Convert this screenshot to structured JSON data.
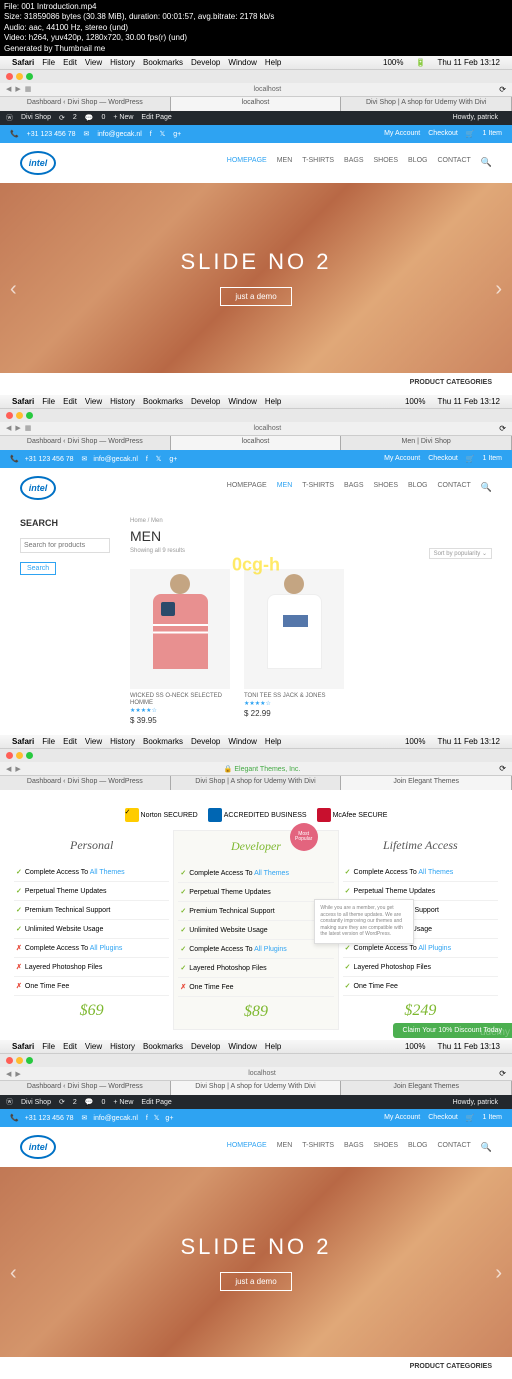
{
  "video_info": {
    "file": "File: 001 Introduction.mp4",
    "size": "Size: 31859086 bytes (30.38 MiB), duration: 00:01:57, avg.bitrate: 2178 kb/s",
    "audio": "Audio: aac, 44100 Hz, stereo (und)",
    "video": "Video: h264, yuv420p, 1280x720, 30.00 fps(r) (und)",
    "gen": "Generated by Thumbnail me"
  },
  "mac": {
    "app": "Safari",
    "menus": [
      "File",
      "Edit",
      "View",
      "History",
      "Bookmarks",
      "Develop",
      "Window",
      "Help"
    ],
    "battery": "100%",
    "datetime1": "Thu 11 Feb 13:12",
    "datetime2": "Thu 11 Feb 13:12",
    "datetime3": "Thu 11 Feb 13:12",
    "datetime4": "Thu 11 Feb 13:13"
  },
  "tabs": {
    "t1": "Dashboard ‹ Divi Shop — WordPress",
    "t2": "localhost",
    "t3": "Divi Shop | A shop for Udemy With Divi",
    "t4": "Men | Divi Shop",
    "t5": "Elegant Themes, Inc.",
    "t6": "Join Elegant Themes",
    "url": "localhost"
  },
  "wp": {
    "site": "Divi Shop",
    "updates": "2",
    "comments": "0",
    "new": "+ New",
    "edit": "Edit Page",
    "howdy": "Howdy, patrick"
  },
  "topbar": {
    "phone": "+31 123 456 78",
    "email": "info@gecak.nl",
    "account": "My Account",
    "checkout": "Checkout",
    "cart": "1 Item"
  },
  "logo": "intel",
  "nav": {
    "home": "HOMEPAGE",
    "men": "MEN",
    "tshirts": "T-SHIRTS",
    "bags": "BAGS",
    "shoes": "SHOES",
    "blog": "BLOG",
    "contact": "CONTACT"
  },
  "hero": {
    "title": "SLIDE NO 2",
    "btn": "just a demo"
  },
  "prod_cat": "PRODUCT CATEGORIES",
  "search": {
    "title": "SEARCH",
    "placeholder": "Search for products",
    "btn": "Search"
  },
  "shop": {
    "crumb": "Home / Men",
    "title": "MEN",
    "results": "Showing all 9 results",
    "sort": "Sort by popularity",
    "p1": {
      "name": "WICKED SS O-NECK SELECTED HOMME",
      "price": "$ 39.95"
    },
    "p2": {
      "name": "TONI TEE SS JACK & JONES",
      "price": "$ 22.99"
    }
  },
  "pricing": {
    "norton": "Norton SECURED",
    "bbb": "ACCREDITED BUSINESS",
    "mcafee": "McAfee SECURE",
    "pop": "Most Popular",
    "plans": {
      "personal": "Personal",
      "developer": "Developer",
      "lifetime": "Lifetime Access"
    },
    "features": {
      "access": "Complete Access To ",
      "themes": "All Themes",
      "updates": "Perpetual Theme Updates",
      "support": "Premium Technical Support",
      "usage": "Unlimited Website Usage",
      "plugins_pre": "Complete Access To ",
      "plugins": "All Plugins",
      "psd": "Layered Photoshop Files",
      "fee": "One Time Fee"
    },
    "tooltip": "While you are a member, you get access to all theme updates. We are constantly improving our themes and making sure they are compatible with the latest version of WordPress.",
    "prices": {
      "personal": "$69",
      "developer": "$89",
      "lifetime": "$249"
    },
    "claim": "Claim Your 10% Discount Today"
  },
  "watermark": "0cg-h",
  "udemy": "udemy"
}
